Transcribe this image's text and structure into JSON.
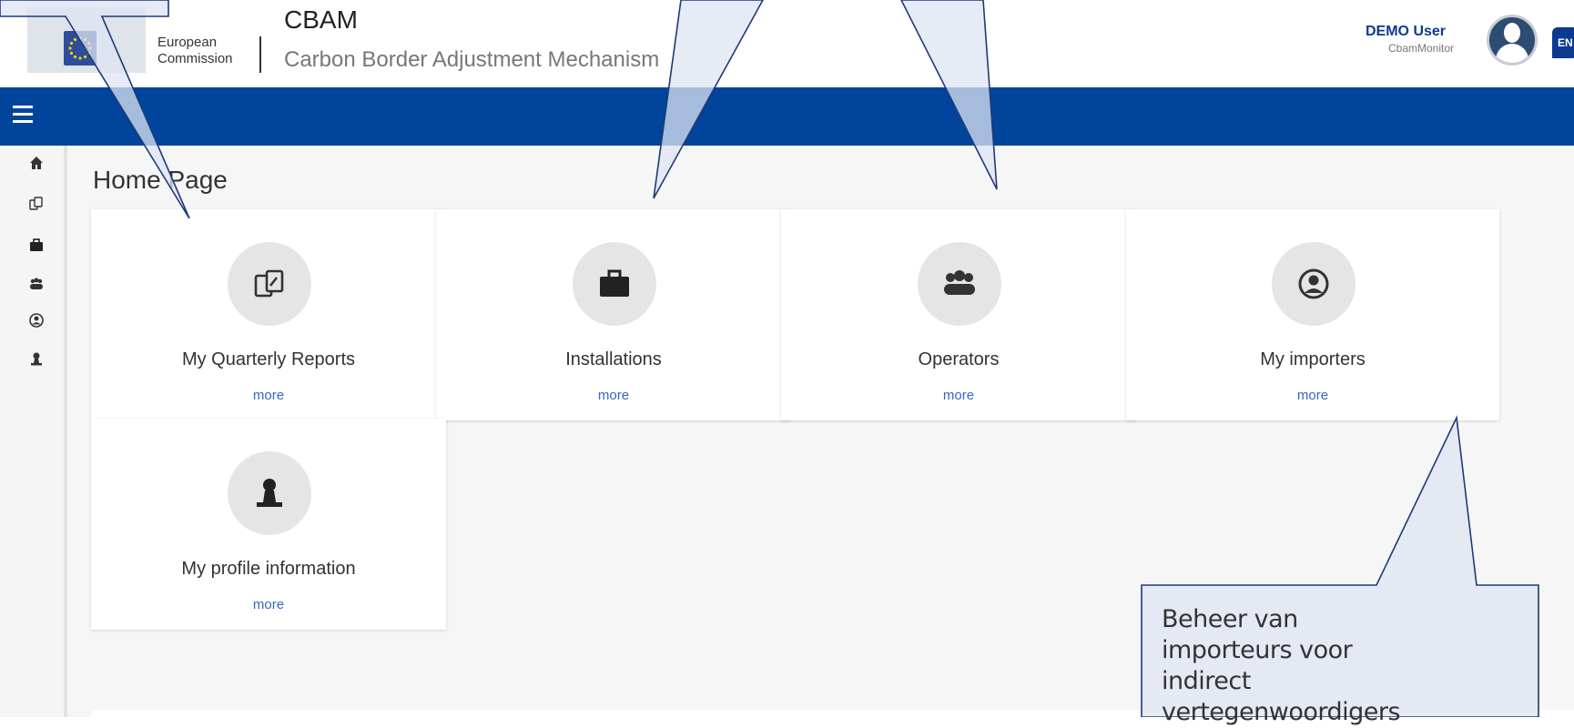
{
  "header": {
    "org_line1": "European",
    "org_line2": "Commission",
    "app_title": "CBAM",
    "app_subtitle": "Carbon Border Adjustment Mechanism",
    "user_name": "DEMO User",
    "user_role": "CbamMonitor",
    "language": "EN"
  },
  "sidebar": {
    "items": [
      {
        "icon": "home-icon"
      },
      {
        "icon": "reports-icon"
      },
      {
        "icon": "briefcase-icon"
      },
      {
        "icon": "group-icon"
      },
      {
        "icon": "user-circle-icon"
      },
      {
        "icon": "user-icon"
      }
    ]
  },
  "main": {
    "page_title": "Home Page",
    "cards": [
      {
        "label": "My Quarterly Reports",
        "more": "more",
        "icon": "reports-icon"
      },
      {
        "label": "Installations",
        "more": "more",
        "icon": "briefcase-icon"
      },
      {
        "label": "Operators",
        "more": "more",
        "icon": "group-icon"
      },
      {
        "label": "My importers",
        "more": "more",
        "icon": "user-circle-icon"
      },
      {
        "label": "My profile information",
        "more": "more",
        "icon": "user-icon"
      }
    ]
  },
  "callout": {
    "text": "Beheer van importeurs voor indirect vertegenwoordigers"
  },
  "colors": {
    "brand_blue": "#00449c",
    "link": "#3766c4",
    "callout_fill": "#dde4f2",
    "callout_stroke": "#1f3a78"
  }
}
